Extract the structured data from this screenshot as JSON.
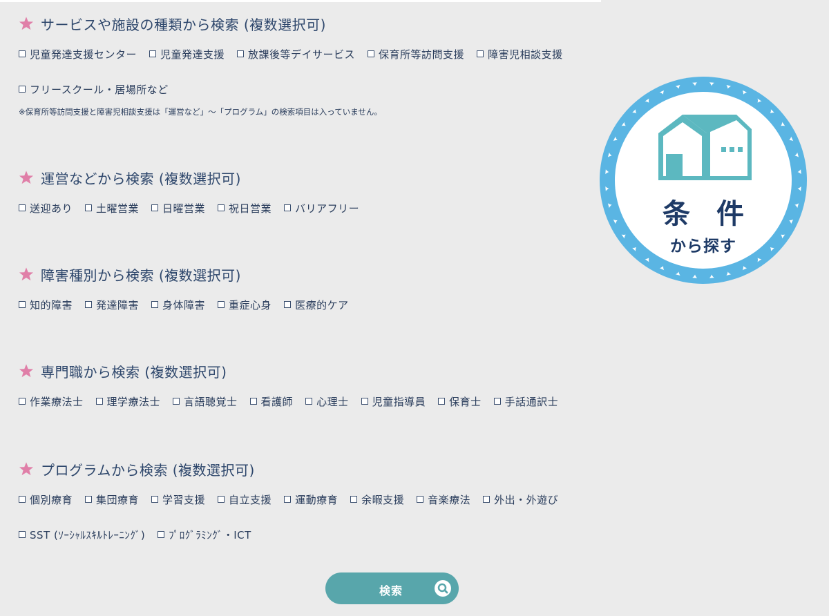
{
  "sections": [
    {
      "title": "サービスや施設の種類から検索 (複数選択可)",
      "rows": [
        [
          "児童発達支援センター",
          "児童発達支援",
          "放課後等デイサービス",
          "保育所等訪問支援",
          "障害児相談支援"
        ],
        [
          "フリースクール・居場所など"
        ]
      ],
      "note": "※保育所等訪問支援と障害児相談支援は「運営など」～「プログラム」の検索項目は入っていません。"
    },
    {
      "title": "運営などから検索 (複数選択可)",
      "rows": [
        [
          "送迎あり",
          "土曜営業",
          "日曜営業",
          "祝日営業",
          "バリアフリー"
        ]
      ]
    },
    {
      "title": "障害種別から検索 (複数選択可)",
      "rows": [
        [
          "知的障害",
          "発達障害",
          "身体障害",
          "重症心身",
          "医療的ケア"
        ]
      ]
    },
    {
      "title": "専門職から検索 (複数選択可)",
      "rows": [
        [
          "作業療法士",
          "理学療法士",
          "言語聴覚士",
          "看護師",
          "心理士",
          "児童指導員",
          "保育士",
          "手話通訳士"
        ]
      ]
    },
    {
      "title": "プログラムから検索 (複数選択可)",
      "rows": [
        [
          "個別療育",
          "集団療育",
          "学習支援",
          "自立支援",
          "運動療育",
          "余暇支援",
          "音楽療法",
          "外出・外遊び"
        ],
        [
          "SST (ｿｰｼｬﾙｽｷﾙﾄﾚｰﾆﾝｸﾞ)",
          "ﾌﾟﾛｸﾞﾗﾐﾝｸﾞ・ICT"
        ]
      ]
    }
  ],
  "badge": {
    "line1": "条 件",
    "line2": "から探す",
    "icon": "house-icon"
  },
  "search_button": {
    "label": "検索",
    "icon": "search-icon"
  },
  "colors": {
    "star": "#e07fa8",
    "badge_ring": "#5ab5e3",
    "house": "#5cb8c0",
    "button": "#58a6ab",
    "text": "#2a3d5c"
  }
}
